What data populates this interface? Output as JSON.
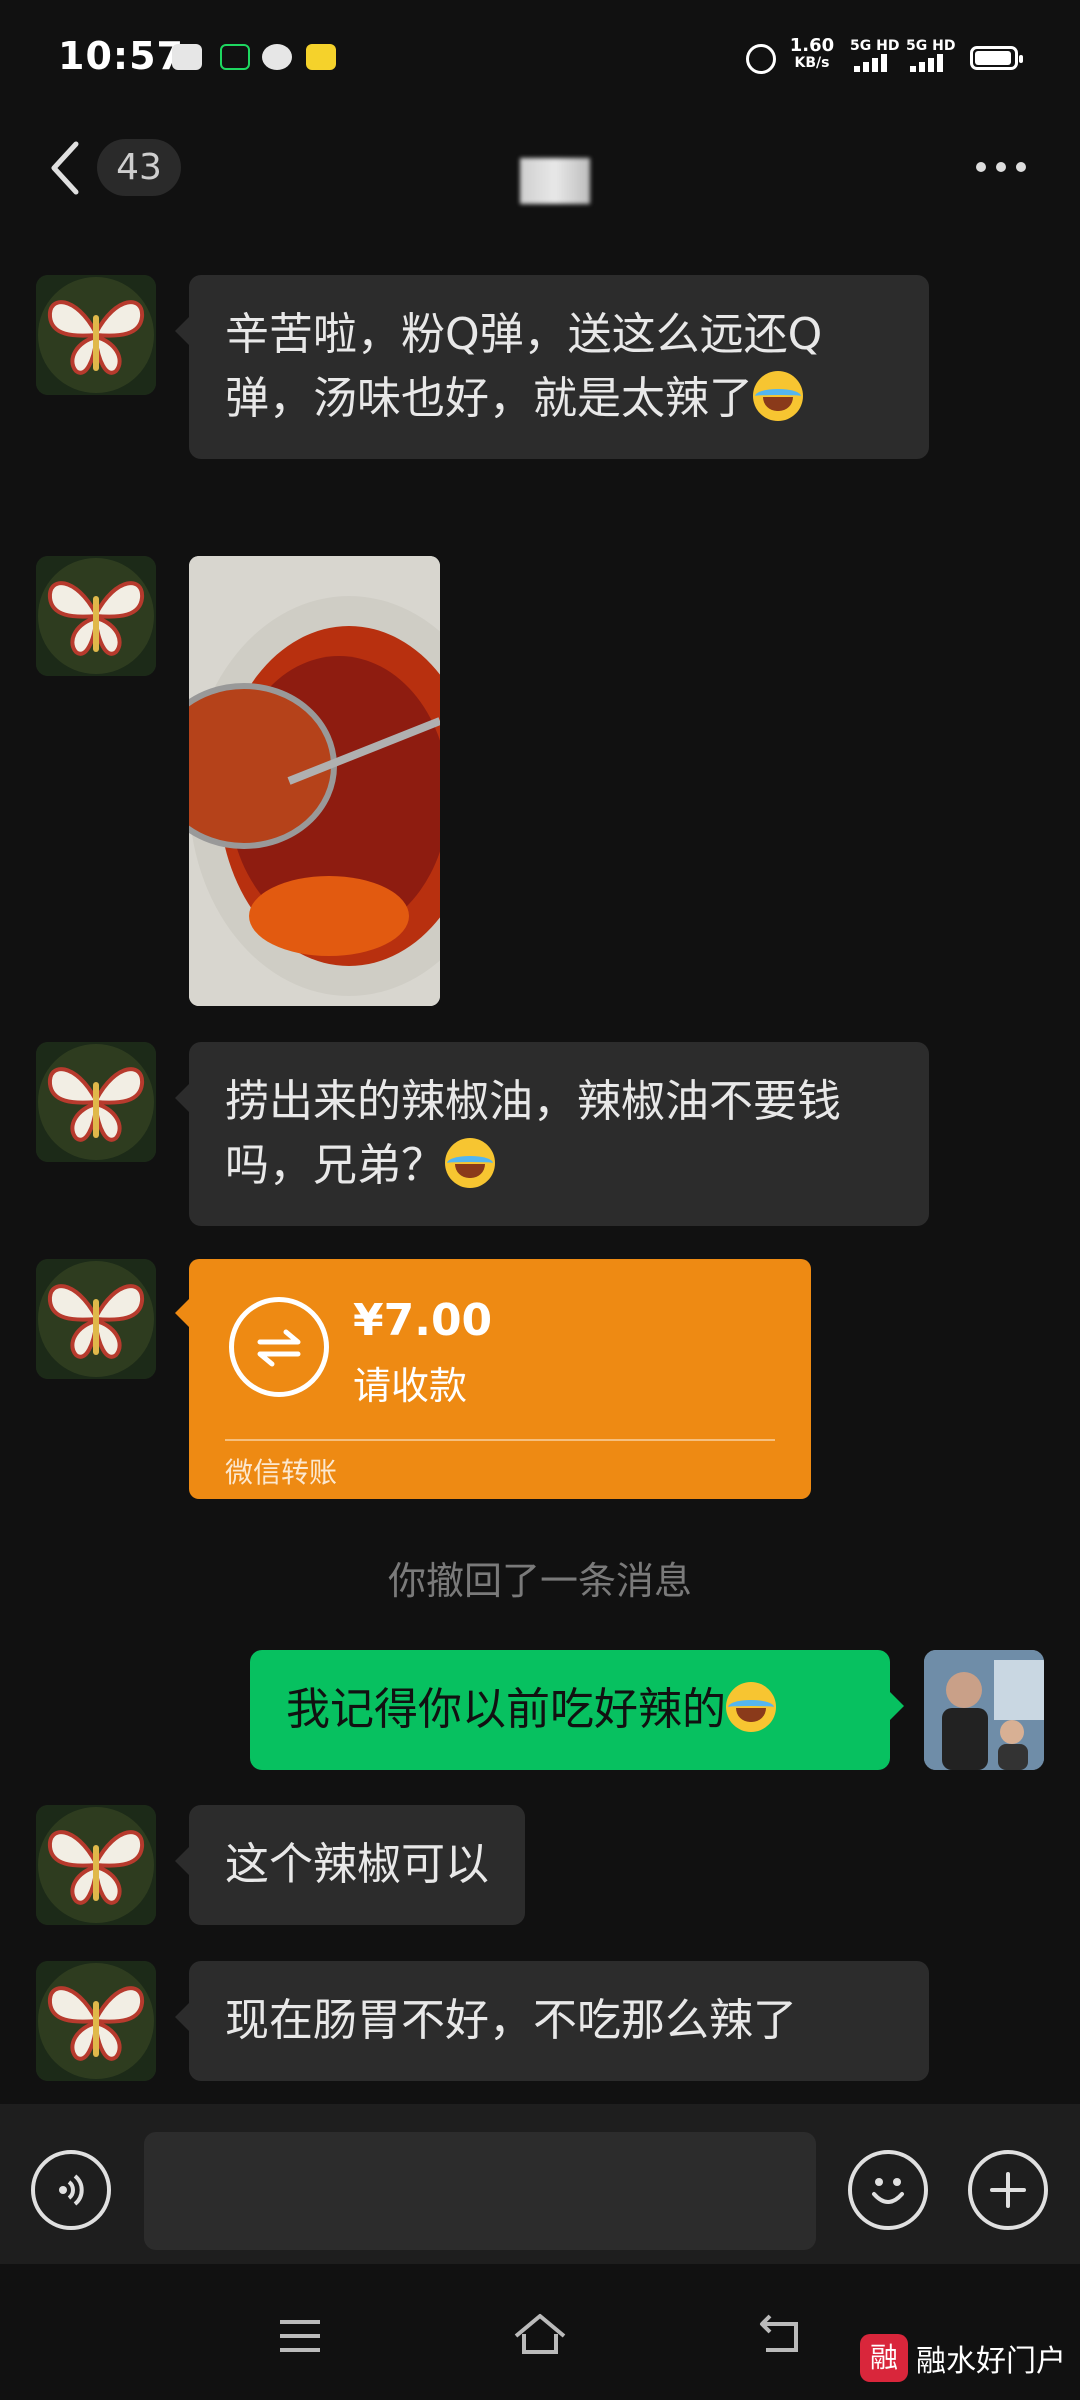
{
  "status_bar": {
    "time": "10:57",
    "net_speed_value": "1.60",
    "net_speed_unit": "KB/s",
    "sim1_label": "5G HD",
    "sim2_label": "5G HD",
    "battery_level": 0.95
  },
  "header": {
    "unread_count": "43"
  },
  "messages": [
    {
      "side": "left",
      "type": "text",
      "text": "辛苦啦，粉Q弹，送这么远还Q弹，汤味也好，就是太辣了",
      "emoji": "face-with-tears-of-joy"
    },
    {
      "side": "left",
      "type": "image"
    },
    {
      "side": "left",
      "type": "text",
      "text": "捞出来的辣椒油，辣椒油不要钱吗，兄弟？",
      "emoji": "face-with-tears-of-joy"
    },
    {
      "side": "left",
      "type": "transfer",
      "amount": "¥7.00",
      "status": "请收款",
      "footer": "微信转账"
    },
    {
      "type": "system",
      "text": "你撤回了一条消息"
    },
    {
      "side": "right",
      "type": "text",
      "text": "我记得你以前吃好辣的",
      "emoji": "face-with-tears-of-joy"
    },
    {
      "side": "left",
      "type": "text",
      "text": "这个辣椒可以"
    },
    {
      "side": "left",
      "type": "text",
      "text": "现在肠胃不好，不吃那么辣了"
    }
  ],
  "input_bar": {
    "voice_icon": "voice-icon",
    "emoji_icon": "emoji-icon",
    "add_icon": "plus-icon",
    "input_value": ""
  },
  "nav_bar": {
    "items": [
      "menu-icon",
      "home-icon",
      "back-icon"
    ]
  },
  "watermark": {
    "logo_char": "融",
    "text": "融水好门户"
  },
  "colors": {
    "background": "#111111",
    "bubble_left": "#2c2c2c",
    "bubble_right": "#07c160",
    "transfer": "#ee8a13"
  }
}
